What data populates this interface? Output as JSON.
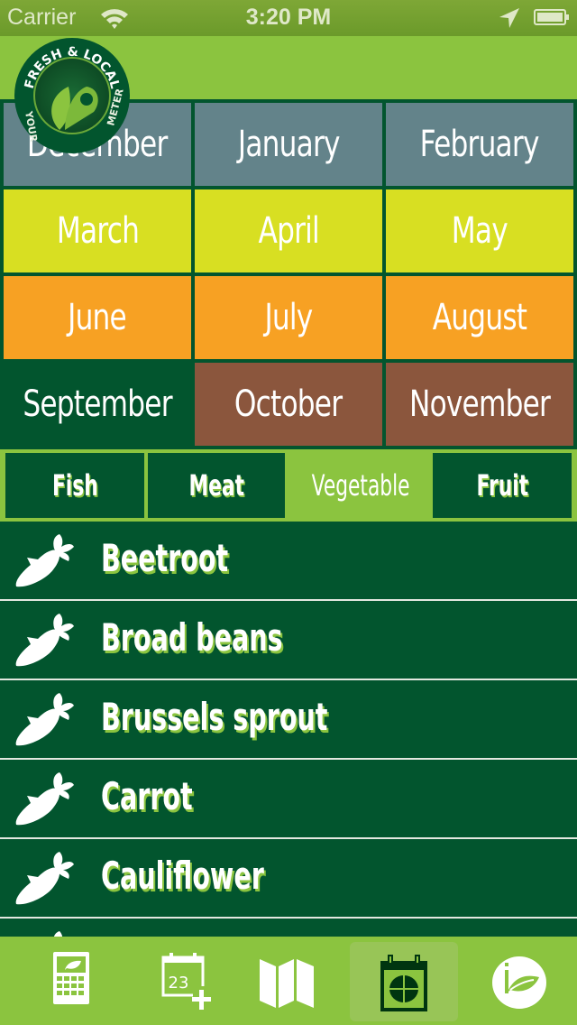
{
  "status_bar": {
    "carrier": "Carrier",
    "time": "3:20 PM",
    "icons": [
      "wifi-icon",
      "location-arrow-icon",
      "battery-icon"
    ]
  },
  "logo": {
    "top_text": "FRESH & LOCAL",
    "bottom_left_text": "YOUR",
    "bottom_right_text": "METER"
  },
  "months": [
    {
      "label": "December",
      "color": "#63838a"
    },
    {
      "label": "January",
      "color": "#63838a"
    },
    {
      "label": "February",
      "color": "#63838a"
    },
    {
      "label": "March",
      "color": "#d8df22"
    },
    {
      "label": "April",
      "color": "#d8df22"
    },
    {
      "label": "May",
      "color": "#d8df22"
    },
    {
      "label": "June",
      "color": "#f7a123"
    },
    {
      "label": "July",
      "color": "#f7a123"
    },
    {
      "label": "August",
      "color": "#f7a123"
    },
    {
      "label": "September",
      "color": "#02552e",
      "selected": true
    },
    {
      "label": "October",
      "color": "#8b563d"
    },
    {
      "label": "November",
      "color": "#8b563d"
    }
  ],
  "categories": [
    {
      "label": "Fish",
      "active": false
    },
    {
      "label": "Meat",
      "active": false
    },
    {
      "label": "Vegetable",
      "active": true
    },
    {
      "label": "Fruit",
      "active": false
    }
  ],
  "items": [
    {
      "label": "Beetroot",
      "icon": "carrot-icon"
    },
    {
      "label": "Broad beans",
      "icon": "carrot-icon"
    },
    {
      "label": "Brussels sprout",
      "icon": "carrot-icon"
    },
    {
      "label": "Carrot",
      "icon": "carrot-icon"
    },
    {
      "label": "Cauliflower",
      "icon": "carrot-icon"
    },
    {
      "label": "",
      "icon": "carrot-icon"
    }
  ],
  "tab_bar": [
    {
      "name": "calculator-leaf-icon",
      "active": false
    },
    {
      "name": "calendar-add-icon",
      "active": false,
      "badge_text": "23"
    },
    {
      "name": "map-icon",
      "active": false
    },
    {
      "name": "seasonal-calendar-icon",
      "active": true
    },
    {
      "name": "info-leaf-icon",
      "active": false
    }
  ],
  "colors": {
    "dark_green": "#02552e",
    "light_green": "#8bc43f",
    "separator": "#e3e8e0"
  }
}
